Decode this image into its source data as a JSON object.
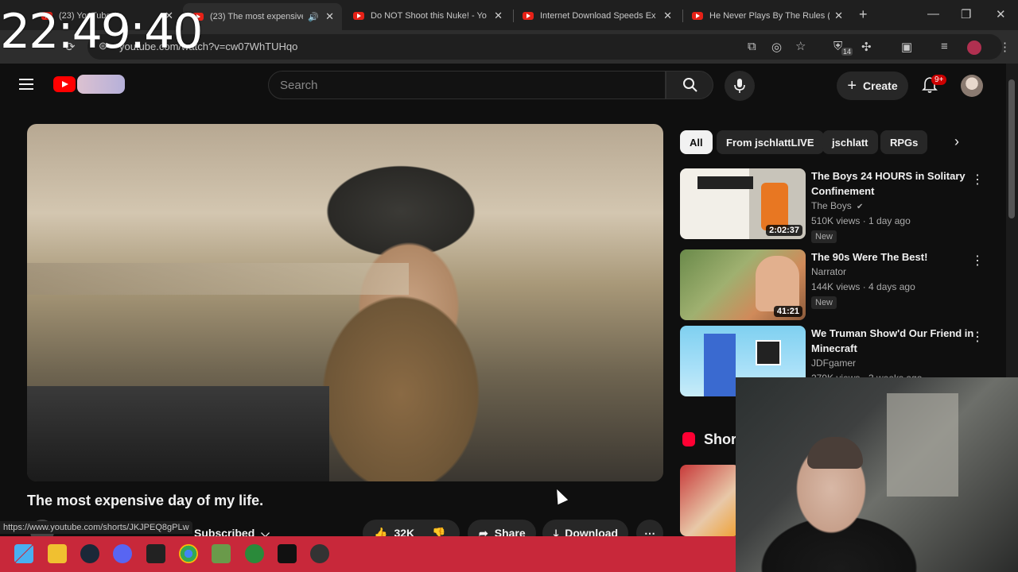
{
  "clock": "22:49:40",
  "browser": {
    "tabs": [
      {
        "title": "(23) YouTube"
      },
      {
        "title": "(23) The most expensive d"
      },
      {
        "title": "Do NOT Shoot this Nuke! - Yo"
      },
      {
        "title": "Internet Download Speeds Ex"
      },
      {
        "title": "He Never Plays By The Rules ("
      }
    ],
    "new_tab_label": "+",
    "url": "youtube.com/watch?v=cw07WhTUHqo",
    "extensions_badge": "14"
  },
  "youtube": {
    "search_placeholder": "Search",
    "create_label": "Create",
    "notif_badge": "9+",
    "video_title": "The most expensive day of my life.",
    "subscribed_label": "Subscribed",
    "like_count": "32K",
    "share_label": "Share",
    "download_label": "Download",
    "status_url": "https://www.youtube.com/shorts/JKJPEQ8gPLw",
    "chips": [
      "All",
      "From jschlattLIVE",
      "jschlatt",
      "RPGs"
    ],
    "recommendations": [
      {
        "title": "The Boys 24 HOURS in Solitary Confinement",
        "channel": "The Boys",
        "verified": true,
        "meta": "510K views · 1 day ago",
        "badge": "New",
        "duration": "2:02:37"
      },
      {
        "title": "The 90s Were The Best!",
        "channel": "Narrator",
        "verified": false,
        "meta": "144K views · 4 days ago",
        "badge": "New",
        "duration": "41:21"
      },
      {
        "title": "We Truman Show'd Our Friend in Minecraft",
        "channel": "JDFgamer",
        "verified": false,
        "meta": "279K views · 3 weeks ago",
        "badge": "",
        "duration": ""
      }
    ],
    "shorts_label": "Shorts"
  },
  "colors": {
    "taskbar": "#c8283a",
    "yt_red": "#ff0000"
  }
}
